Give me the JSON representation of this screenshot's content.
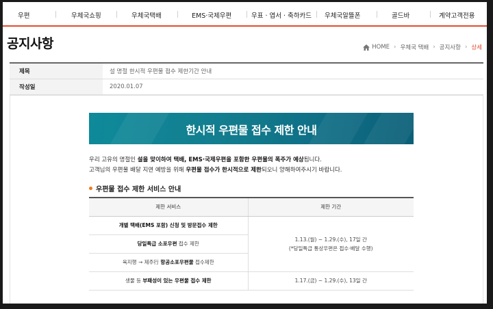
{
  "nav": {
    "items": [
      "우편",
      "우체국쇼핑",
      "우체국택배",
      "EMS·국제우편",
      "우표 · 엽서 · 축하카드",
      "우체국알뜰폰",
      "골드바",
      "계약고객전용"
    ]
  },
  "page_title": "공지사항",
  "breadcrumb": {
    "home": "HOME",
    "level1": "우체국 택배",
    "level2": "공지사항",
    "current": "상세"
  },
  "info": {
    "subject_label": "제목",
    "subject_value": "설 명절 한시적 우편물 접수 제한기간 안내",
    "date_label": "작성일",
    "date_value": "2020.01.07"
  },
  "banner": {
    "title": "한시적 우편물 접수 제한 안내"
  },
  "intro": {
    "l1a": "우리 고유의 명절인 ",
    "l1b": "설을 맞이하여 택배, EMS·국제우편을 포함한 우편물의 폭주가 예상",
    "l1c": "됩니다.",
    "l2a": "고객님의 우편물 배달 지연 예방을 위해 ",
    "l2b": "우편물 접수가 한시적으로 제한",
    "l2c": "되오니 양해하여주시기 바랍니다."
  },
  "section": {
    "title": "우편물 접수 제한 서비스 안내"
  },
  "table": {
    "col_service": "제한 서비스",
    "col_period": "제한 기간",
    "r1": "개별 택배(EMS 포함) 신청 및 방문접수 제한",
    "r2a": "당일특급 소포우편",
    "r2b": " 접수 제한",
    "r3a": "육지행 → 제주行 ",
    "r3b": "항공소포우편물",
    "r3c": " 접수제한",
    "period1_l1": "1.13.(월) ~ 1.29.(수), 17일 간",
    "period1_l2": "(*당일특급 통상우편은 접수·배달 수행)",
    "r4a": "생물 등 ",
    "r4b": "부패성이 있는 우편물 접수 제한",
    "period2": "1.17.(금) ~ 1.29.(수), 13일 간"
  },
  "colors": {
    "accent": "#e34a2e",
    "banner": "#0f7a8c",
    "bullet": "#f07a1a"
  }
}
